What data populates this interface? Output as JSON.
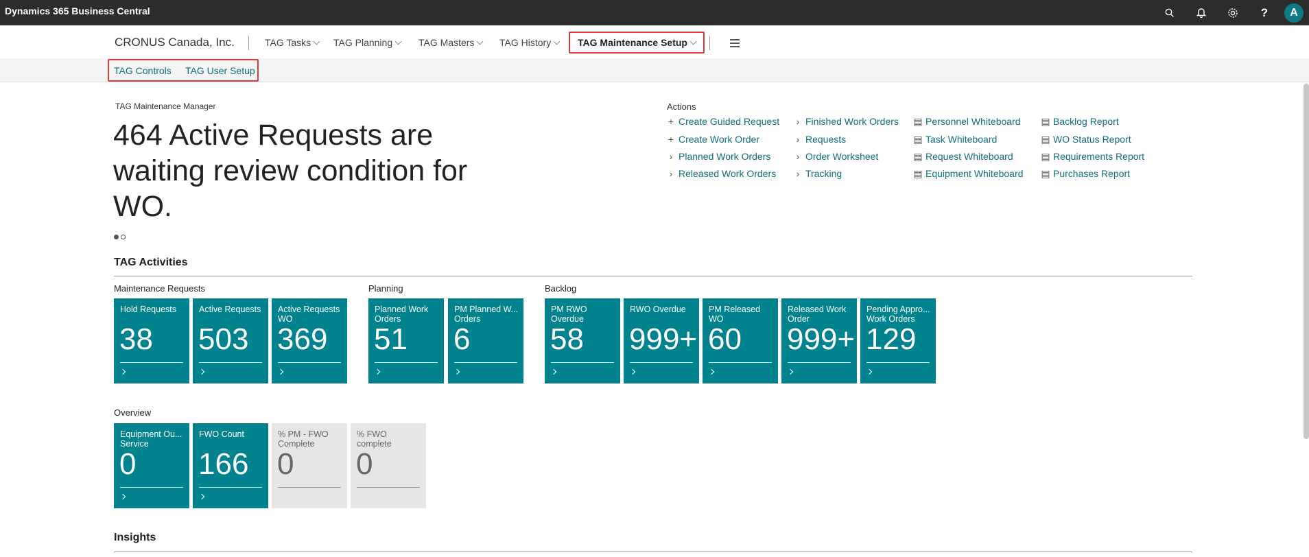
{
  "app": {
    "title": "Dynamics 365 Business Central",
    "avatar": "A"
  },
  "icons": [
    "search-icon",
    "bell-icon",
    "gear-icon",
    "help-icon"
  ],
  "nav": {
    "company": "CRONUS Canada, Inc.",
    "menus": [
      "TAG Tasks",
      "TAG Planning",
      "TAG Masters",
      "TAG History",
      "TAG Maintenance Setup"
    ]
  },
  "subnav": {
    "items": [
      "TAG Controls",
      "TAG User Setup"
    ]
  },
  "headline": {
    "role": "TAG Maintenance Manager",
    "text": "464 Active Requests are waiting review condition for WO."
  },
  "actions": {
    "title": "Actions",
    "col1": [
      "Create Guided Request",
      "Create Work Order",
      "Planned Work Orders",
      "Released Work Orders"
    ],
    "col2": [
      "Finished Work Orders",
      "Requests",
      "Order Worksheet",
      "Tracking"
    ],
    "col3": [
      "Personnel Whiteboard",
      "Task Whiteboard",
      "Request Whiteboard",
      "Equipment Whiteboard"
    ],
    "col4": [
      "Backlog Report",
      "WO Status Report",
      "Requirements Report",
      "Purchases Report"
    ]
  },
  "activities": {
    "title": "TAG Activities",
    "groups": [
      "Maintenance Requests",
      "Planning",
      "Backlog",
      "Overview"
    ],
    "tiles": [
      {
        "title": "Hold Requests",
        "value": "38"
      },
      {
        "title": "Active Requests",
        "value": "503"
      },
      {
        "title": "Active Requests WO",
        "value": "369"
      },
      {
        "title": "Planned Work Orders",
        "value": "51"
      },
      {
        "title": "PM Planned W... Orders",
        "value": "6"
      },
      {
        "title": "PM RWO Overdue",
        "value": "58"
      },
      {
        "title": "RWO Overdue",
        "value": "999+"
      },
      {
        "title": "PM Released WO",
        "value": "60"
      },
      {
        "title": "Released Work Order",
        "value": "999+"
      },
      {
        "title": "Pending Appro... Work Orders",
        "value": "129"
      },
      {
        "title": "Equipment Ou... Service",
        "value": "0"
      },
      {
        "title": "FWO Count",
        "value": "166"
      },
      {
        "title": "% PM - FWO Complete",
        "value": "0"
      },
      {
        "title": "% FWO complete",
        "value": "0"
      }
    ]
  },
  "insights": {
    "title": "Insights"
  },
  "colors": {
    "accent": "#00838f",
    "link": "#0e6f7a",
    "highlight": "#e0393e"
  }
}
